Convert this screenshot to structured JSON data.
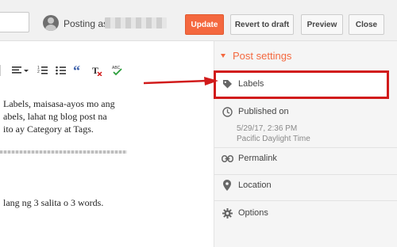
{
  "topbar": {
    "posting_as": "Posting as",
    "update": "Update",
    "revert": "Revert to draft",
    "preview": "Preview",
    "close": "Close"
  },
  "toolbar": {
    "icons": [
      "align-icon",
      "numbered-list-icon",
      "bullet-list-icon",
      "quote-icon",
      "clear-formatting-icon",
      "spellcheck-icon"
    ]
  },
  "editor": {
    "lines": [
      "Labels, maisasa-ayos mo ang",
      "abels, lahat ng blog post na",
      "ito ay Category at Tags.",
      "lang ng 3 salita o 3 words."
    ]
  },
  "sidebar": {
    "header": "Post settings",
    "labels": "Labels",
    "published_on": "Published on",
    "published_date": "5/29/17, 2:36 PM",
    "published_tz": "Pacific Daylight Time",
    "permalink": "Permalink",
    "location": "Location",
    "options": "Options"
  },
  "colors": {
    "accent": "#f4683f",
    "highlight_border": "#d11b1b",
    "arrow": "#d11b1b"
  }
}
